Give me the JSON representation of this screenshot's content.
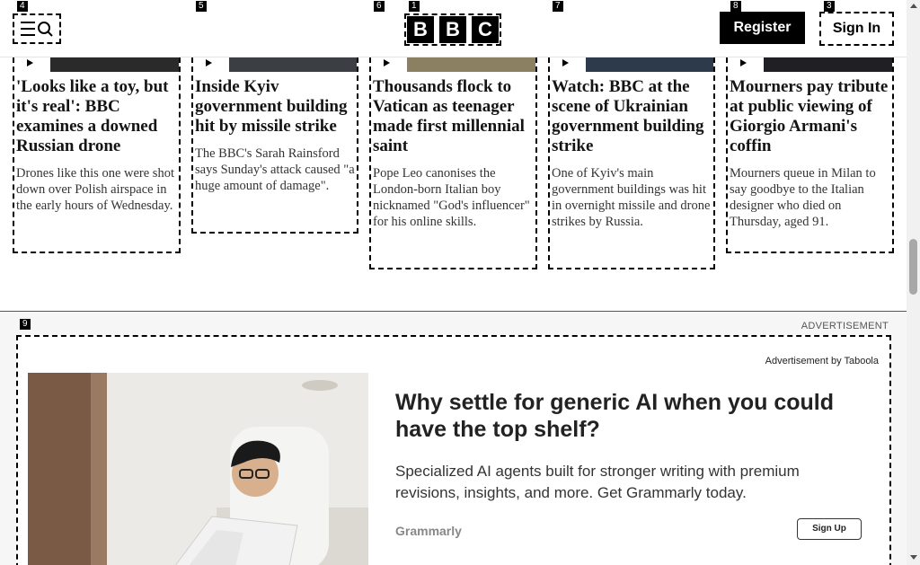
{
  "header": {
    "logo_letters": [
      "B",
      "B",
      "C"
    ],
    "register_label": "Register",
    "signin_label": "Sign In",
    "menu_icon": "menu-search-icon"
  },
  "badges": {
    "logo": "1",
    "signin": "3",
    "menu": "4",
    "card1": "5",
    "card2": "6",
    "card3": "7",
    "card4": "8",
    "ad": "9"
  },
  "articles": [
    {
      "title": "'Looks like a toy, but it's real': BBC examines a downed Russian drone",
      "summary": "Drones like this one were shot down over Polish airspace in the early hours of Wednesday."
    },
    {
      "title": "Inside Kyiv government building hit by missile strike",
      "summary": "The BBC's Sarah Rainsford says Sunday's attack caused \"a huge amount of damage\"."
    },
    {
      "title": "Thousands flock to Vatican as teenager made first millennial saint",
      "summary": "Pope Leo canonises the London-born Italian boy nicknamed \"God's influencer\" for his online skills."
    },
    {
      "title": "Watch: BBC at the scene of Ukrainian government building strike",
      "summary": "One of Kyiv's main government buildings was hit in overnight missile and drone strikes by Russia."
    },
    {
      "title": "Mourners pay tribute at public viewing of Giorgio Armani's coffin",
      "summary": "Mourners queue in Milan to say goodbye to the Italian designer who died on Thursday, aged 91."
    }
  ],
  "advertisement": {
    "label": "ADVERTISEMENT",
    "attribution": "Advertisement by Taboola",
    "title": "Why settle for generic AI when you could have the top shelf?",
    "description": "Specialized AI agents built for stronger writing with premium revisions, insights, and more. Get Grammarly today.",
    "brand": "Grammarly",
    "cta": "Sign Up"
  }
}
